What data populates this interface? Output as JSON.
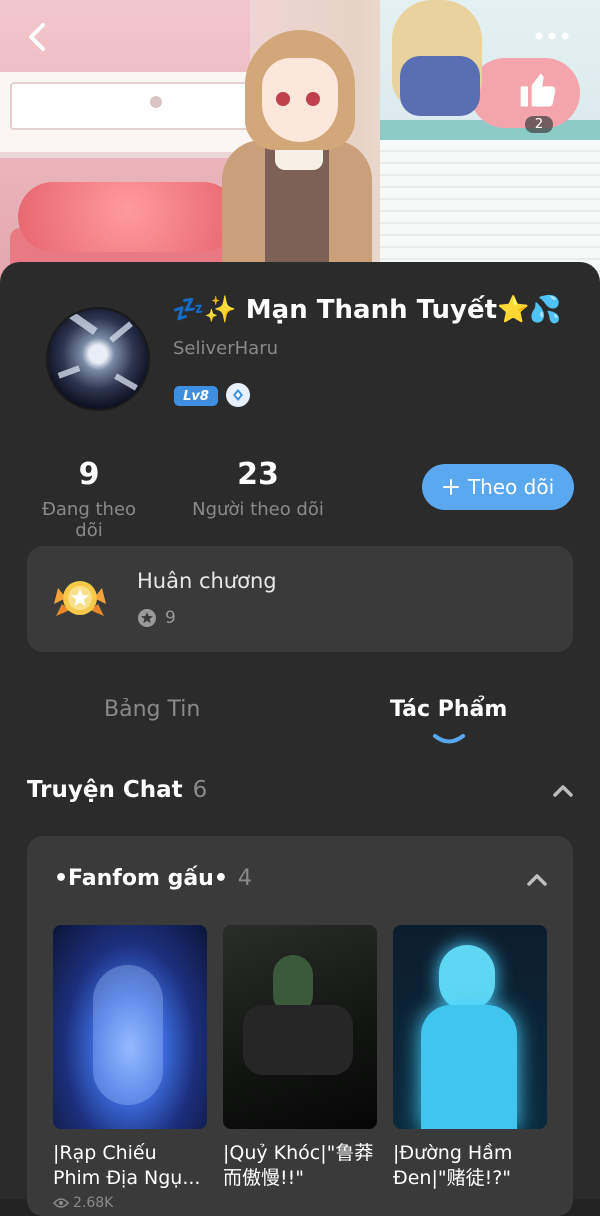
{
  "header": {
    "like_count": "2"
  },
  "profile": {
    "name": "💤✨ Mạn Thanh Tuyết⭐💦",
    "handle": "SeliverHaru",
    "level": "Lv8"
  },
  "stats": {
    "following_count": "9",
    "following_label": "Đang theo dõi",
    "followers_count": "23",
    "followers_label": "Người theo dõi",
    "follow_button": "Theo dõi"
  },
  "medals": {
    "title": "Huân chương",
    "count": "9"
  },
  "tabs": {
    "feed": "Bảng Tin",
    "works": "Tác Phẩm"
  },
  "section": {
    "title": "Truyện Chat",
    "count": "6"
  },
  "fandom": {
    "title": "•Fanfom gấu•",
    "count": "4",
    "stories": [
      {
        "title": "|Rạp Chiếu Phim Địa Ngụ...",
        "views": "2.68K"
      },
      {
        "title": "|Quỷ Khóc|\"鲁莽而傲慢!!\"",
        "views": ""
      },
      {
        "title": "|Đường Hầm Đen|\"赌徒!?\"",
        "views": ""
      }
    ]
  },
  "colors": {
    "accent": "#5aa8ef",
    "card_bg": "#2b2b2b",
    "box_bg": "#3a3a3a",
    "muted": "#8a8a8a"
  },
  "icons": [
    "back-arrow-icon",
    "more-dots-icon",
    "thumbs-up-icon",
    "diamond-icon",
    "plus-icon",
    "medal-icon",
    "star-badge-icon",
    "chevron-up-icon",
    "eye-icon"
  ]
}
